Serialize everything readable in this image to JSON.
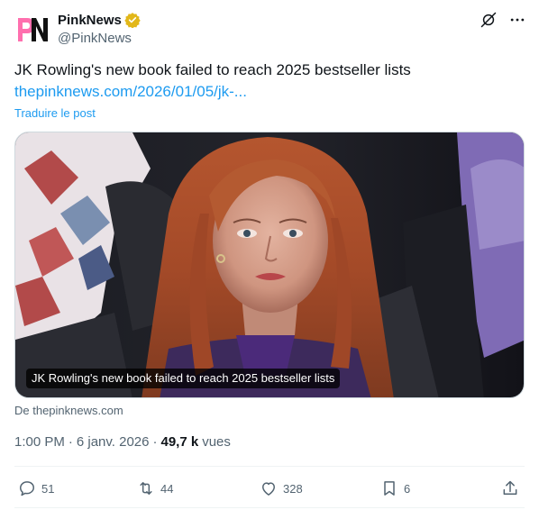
{
  "author": {
    "display_name": "PinkNews",
    "handle": "@PinkNews",
    "avatar_text": "PN",
    "brand_color": "#ff69b4"
  },
  "post": {
    "text": "JK Rowling's new book failed to reach 2025 bestseller lists",
    "link": "thepinknews.com/2026/01/05/jk-...",
    "translate_label": "Traduire le post"
  },
  "card": {
    "title": "JK Rowling's new book failed to reach 2025 bestseller lists",
    "source": "De thepinknews.com"
  },
  "meta": {
    "time": "1:00 PM",
    "date": "6 janv. 2026",
    "separator": "·",
    "views_count": "49,7 k",
    "views_label": "vues"
  },
  "actions": {
    "replies": "51",
    "reposts": "44",
    "likes": "328",
    "bookmarks": "6"
  },
  "icons": {
    "verified": "verified-badge-icon",
    "grok": "grok-icon",
    "more": "more-icon",
    "reply": "reply-icon",
    "repost": "repost-icon",
    "like": "heart-icon",
    "bookmark": "bookmark-icon",
    "share": "share-icon"
  },
  "colors": {
    "link": "#1d9bf0",
    "secondary_text": "#536471",
    "verified_gold": "#e2b719"
  }
}
